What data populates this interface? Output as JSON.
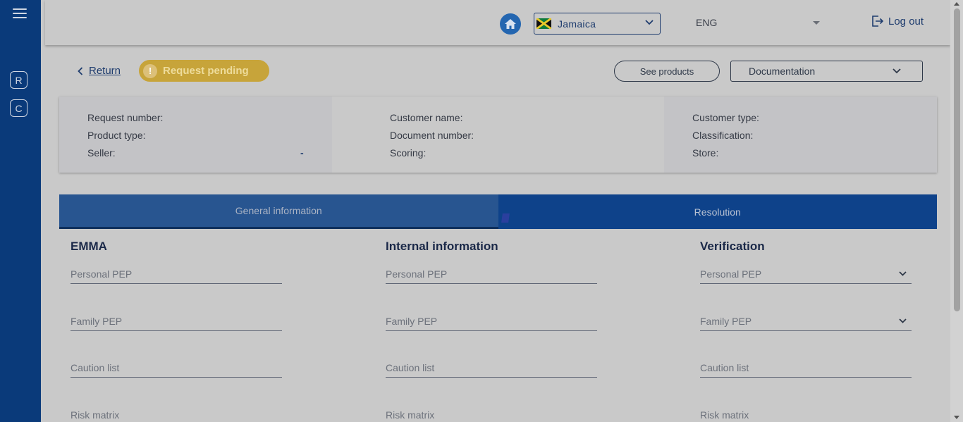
{
  "colors": {
    "sidebar": "#0a3a7a",
    "accent": "#2466b0",
    "pending": "#c7a43a",
    "tab_active": "#285590",
    "tab_inactive": "#0e428a"
  },
  "sidebar": {
    "menu_icon": "hamburger-icon",
    "items": [
      {
        "label": "R"
      },
      {
        "label": "C"
      }
    ]
  },
  "topbar": {
    "home_icon": "home-icon",
    "country": "Jamaica",
    "language": "ENG",
    "logout_label": "Log out"
  },
  "subheader": {
    "return_label": "Return",
    "status_label": "Request pending",
    "status_icon": "!",
    "see_products_label": "See products",
    "documentation_label": "Documentation"
  },
  "summary": {
    "request_number": "Request number:",
    "product_type": "Product type:",
    "seller": "Seller:",
    "seller_value": "-",
    "customer_name": "Customer name:",
    "document_number": "Document number:",
    "scoring": "Scoring:",
    "customer_type": "Customer type:",
    "classification": "Classification:",
    "store": "Store:"
  },
  "tabs": [
    {
      "label": "General information",
      "active": true
    },
    {
      "label": "Resolution",
      "active": false
    }
  ],
  "sections": {
    "emma": {
      "title": "EMMA",
      "fields": [
        "Personal PEP",
        "Family PEP",
        "Caution list",
        "Risk matrix"
      ]
    },
    "internal": {
      "title": "Internal information",
      "fields": [
        "Personal PEP",
        "Family PEP",
        "Caution list",
        "Risk matrix"
      ]
    },
    "verification": {
      "title": "Verification",
      "fields": [
        "Personal PEP",
        "Family PEP",
        "Caution list",
        "Risk matrix"
      ]
    }
  }
}
